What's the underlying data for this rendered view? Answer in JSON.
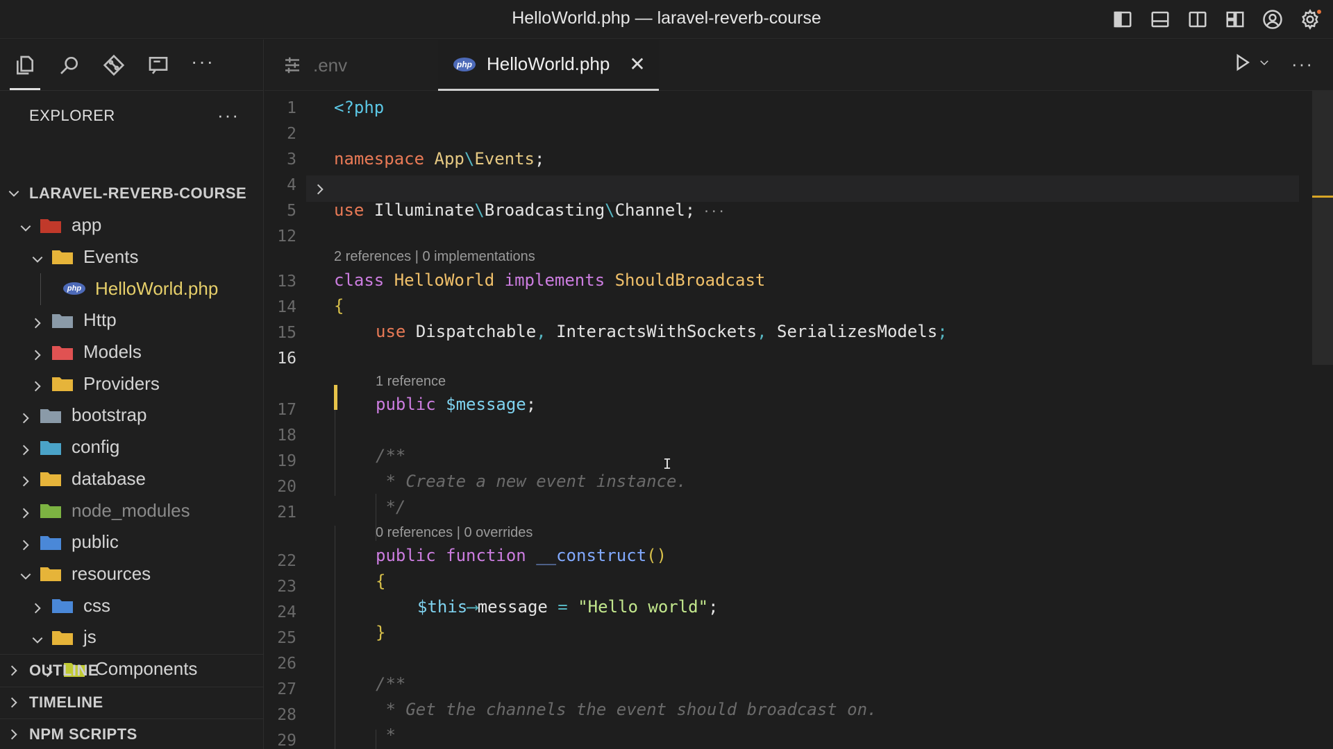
{
  "window": {
    "title": "HelloWorld.php — laravel-reverb-course"
  },
  "titlebar_icons": [
    "toggle-sidebar-icon",
    "toggle-panel-icon",
    "toggle-secondary-sidebar-icon",
    "customize-layout-icon",
    "account-icon",
    "settings-gear-icon"
  ],
  "activity_bar": [
    "explorer-icon",
    "search-icon",
    "source-control-icon",
    "remote-explorer-icon",
    "more-icon"
  ],
  "explorer": {
    "title": "EXPLORER",
    "more": "···",
    "root": "LARAVEL-REVERB-COURSE",
    "items": [
      {
        "label": "app",
        "expanded": true,
        "color": "#c0392b"
      },
      {
        "label": "Events",
        "expanded": true,
        "color": "#e6b43a"
      },
      {
        "label": "HelloWorld.php",
        "file": true
      },
      {
        "label": "Http",
        "expanded": false,
        "color": "#8a9aa8"
      },
      {
        "label": "Models",
        "expanded": false,
        "color": "#e05252"
      },
      {
        "label": "Providers",
        "expanded": false,
        "color": "#e6b43a"
      },
      {
        "label": "bootstrap",
        "expanded": false,
        "color": "#8a9aa8"
      },
      {
        "label": "config",
        "expanded": false,
        "color": "#4aa3c8"
      },
      {
        "label": "database",
        "expanded": false,
        "color": "#e6b43a"
      },
      {
        "label": "node_modules",
        "expanded": false,
        "color": "#7cb342"
      },
      {
        "label": "public",
        "expanded": false,
        "color": "#4a88d8"
      },
      {
        "label": "resources",
        "expanded": true,
        "color": "#e6b43a"
      },
      {
        "label": "css",
        "expanded": false,
        "color": "#4a88d8"
      },
      {
        "label": "js",
        "expanded": true,
        "color": "#e6b43a"
      },
      {
        "label": "Components",
        "expanded": false,
        "color": "#c0ca33"
      }
    ],
    "panels": [
      "OUTLINE",
      "TIMELINE",
      "NPM SCRIPTS"
    ]
  },
  "tabs": [
    {
      "label": ".env",
      "active": false
    },
    {
      "label": "HelloWorld.php",
      "active": true,
      "close": "✕"
    }
  ],
  "php_badge": "php",
  "editor": {
    "line_numbers": [
      "1",
      "2",
      "3",
      "4",
      "5",
      "12",
      "13",
      "14",
      "15",
      "16",
      "17",
      "18",
      "19",
      "20",
      "21",
      "22",
      "23",
      "24",
      "25",
      "26",
      "27",
      "28",
      "29"
    ],
    "current_line": "16",
    "lenses": {
      "class": "2 references | 0 implementations",
      "message": "1 reference",
      "construct": "0 references | 0 overrides"
    },
    "code": {
      "l1": "<?php",
      "l3_kw": "namespace",
      "l3_a": "App",
      "l3_sep": "\\",
      "l3_b": "Events",
      "l3_end": ";",
      "l5_kw": "use",
      "l5_a": "Illuminate",
      "l5_sep1": "\\",
      "l5_b": "Broadcasting",
      "l5_sep2": "\\",
      "l5_c": "Channel",
      "l5_end": ";",
      "l5_fold": "···",
      "l13_kw": "class",
      "l13_name": "HelloWorld",
      "l13_impl": "implements",
      "l13_iface": "ShouldBroadcast",
      "l14": "{",
      "l15_kw": "use",
      "l15_a": "Dispatchable",
      "l15_c1": ",",
      "l15_b": "InteractsWithSockets",
      "l15_c2": ",",
      "l15_c": "SerializesModels",
      "l15_end": ";",
      "l17_kw": "public",
      "l17_var": "$message",
      "l17_end": ";",
      "l19": "/**",
      "l20": " * Create a new event instance.",
      "l21": " */",
      "l22_kw": "public",
      "l22_fn": "function",
      "l22_name": "__construct",
      "l22_paren": "()",
      "l23": "{",
      "l24_this": "$this",
      "l24_arrow": "⟶",
      "l24_prop": "message",
      "l24_eq": " = ",
      "l24_str": "\"Hello world\"",
      "l24_end": ";",
      "l25": "}",
      "l27": "/**",
      "l28": " * Get the channels the event should broadcast on.",
      "l29": " *"
    }
  },
  "mouse_cursor": "I"
}
